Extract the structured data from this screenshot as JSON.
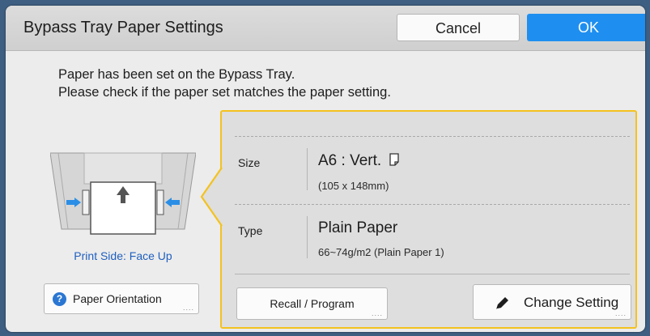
{
  "dialog": {
    "title": "Bypass Tray Paper Settings",
    "cancel_label": "Cancel",
    "ok_label": "OK"
  },
  "message": {
    "line1": "Paper has been set on the Bypass Tray.",
    "line2": "Please check if the paper set matches the paper setting."
  },
  "tray": {
    "print_side": "Print Side: Face Up",
    "orientation_button": "Paper Orientation",
    "icons": [
      "question-icon",
      "tray-illustration",
      "up-arrow-icon",
      "guide-arrow-icon"
    ]
  },
  "settings": {
    "size_label": "Size",
    "size_value": "A6 : Vert.",
    "size_dims": "(105 x 148mm)",
    "type_label": "Type",
    "type_value": "Plain Paper",
    "type_detail": "66~74g/m2 (Plain Paper 1)",
    "recall_button": "Recall / Program",
    "change_button": "Change Setting",
    "more_indicator": "...."
  },
  "colors": {
    "ok_blue": "#1e8ff0",
    "highlight_yellow": "#f4c21e",
    "print_side_blue": "#1f5fbf",
    "background": "#3f5f82"
  }
}
